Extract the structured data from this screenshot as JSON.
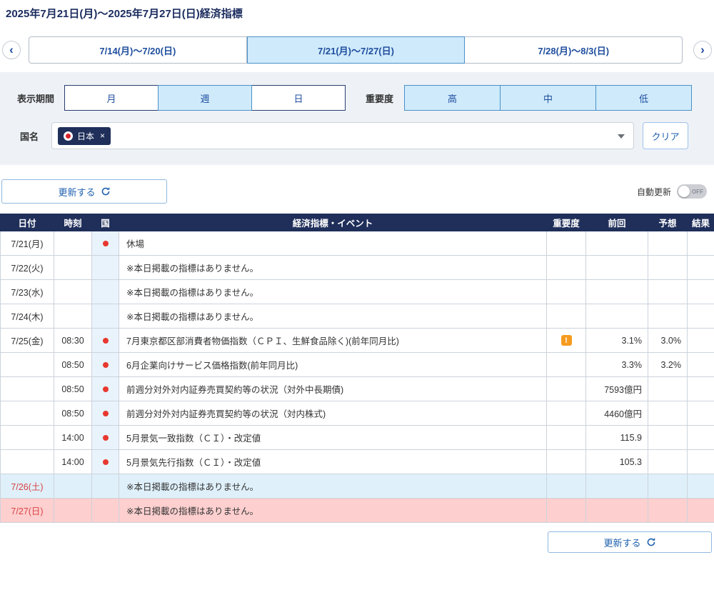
{
  "page": {
    "title": "2025年7月21日(月)～2025年7月27日(日)経済指標"
  },
  "icons": {
    "prev": "‹",
    "next": "›",
    "importance": "!"
  },
  "week_nav": {
    "tabs": [
      {
        "key": "prev-week",
        "label": "7/14(月)～7/20(日)",
        "selected": false
      },
      {
        "key": "current-week",
        "label": "7/21(月)～7/27(日)",
        "selected": true
      },
      {
        "key": "next-week",
        "label": "7/28(月)～8/3(日)",
        "selected": false
      }
    ]
  },
  "filters": {
    "period_label": "表示期間",
    "period_options": [
      {
        "key": "month",
        "label": "月",
        "selected": false
      },
      {
        "key": "week",
        "label": "週",
        "selected": true
      },
      {
        "key": "day",
        "label": "日",
        "selected": false
      }
    ],
    "importance_label": "重要度",
    "importance_options": [
      {
        "key": "high",
        "label": "高",
        "selected": true
      },
      {
        "key": "mid",
        "label": "中",
        "selected": true
      },
      {
        "key": "low",
        "label": "低",
        "selected": true
      }
    ],
    "country_label": "国名",
    "country_tag": {
      "label": "日本",
      "remove": "×"
    },
    "clear_button": "クリア"
  },
  "toolbar": {
    "refresh_button": "更新する",
    "auto_refresh_label": "自動更新",
    "auto_refresh_state": "OFF"
  },
  "table": {
    "headers": [
      "日付",
      "時刻",
      "国",
      "経済指標・イベント",
      "重要度",
      "前回",
      "予想",
      "結果"
    ],
    "rows": [
      {
        "row_type": "weekday",
        "date": "7/21(月)",
        "time": "",
        "country": true,
        "event": "休場",
        "importance": false,
        "previous": "",
        "forecast": "",
        "result": ""
      },
      {
        "row_type": "weekday",
        "date": "7/22(火)",
        "time": "",
        "country": false,
        "event": "※本日掲載の指標はありません。",
        "importance": false,
        "previous": "",
        "forecast": "",
        "result": ""
      },
      {
        "row_type": "weekday",
        "date": "7/23(水)",
        "time": "",
        "country": false,
        "event": "※本日掲載の指標はありません。",
        "importance": false,
        "previous": "",
        "forecast": "",
        "result": ""
      },
      {
        "row_type": "weekday",
        "date": "7/24(木)",
        "time": "",
        "country": false,
        "event": "※本日掲載の指標はありません。",
        "importance": false,
        "previous": "",
        "forecast": "",
        "result": ""
      },
      {
        "row_type": "weekday",
        "date": "7/25(金)",
        "time": "08:30",
        "country": true,
        "event": "7月東京都区部消費者物価指数（ＣＰＩ、生鮮食品除く)(前年同月比)",
        "importance": true,
        "previous": "3.1%",
        "forecast": "3.0%",
        "result": ""
      },
      {
        "row_type": "weekday",
        "date": "",
        "time": "08:50",
        "country": true,
        "event": "6月企業向けサービス価格指数(前年同月比)",
        "importance": false,
        "previous": "3.3%",
        "forecast": "3.2%",
        "result": ""
      },
      {
        "row_type": "weekday",
        "date": "",
        "time": "08:50",
        "country": true,
        "event": "前週分対外対内証券売買契約等の状況（対外中長期債)",
        "importance": false,
        "previous": "7593億円",
        "forecast": "",
        "result": ""
      },
      {
        "row_type": "weekday",
        "date": "",
        "time": "08:50",
        "country": true,
        "event": "前週分対外対内証券売買契約等の状況（対内株式)",
        "importance": false,
        "previous": "4460億円",
        "forecast": "",
        "result": ""
      },
      {
        "row_type": "weekday",
        "date": "",
        "time": "14:00",
        "country": true,
        "event": "5月景気一致指数（ＣＩ）・改定値",
        "importance": false,
        "previous": "115.9",
        "forecast": "",
        "result": ""
      },
      {
        "row_type": "weekday",
        "date": "",
        "time": "14:00",
        "country": true,
        "event": "5月景気先行指数（ＣＩ）・改定値",
        "importance": false,
        "previous": "105.3",
        "forecast": "",
        "result": ""
      },
      {
        "row_type": "saturday",
        "date": "7/26(土)",
        "time": "",
        "country": false,
        "event": "※本日掲載の指標はありません。",
        "importance": false,
        "previous": "",
        "forecast": "",
        "result": ""
      },
      {
        "row_type": "sunday",
        "date": "7/27(日)",
        "time": "",
        "country": false,
        "event": "※本日掲載の指標はありません。",
        "importance": false,
        "previous": "",
        "forecast": "",
        "result": ""
      }
    ]
  },
  "footer": {
    "refresh_button": "更新する"
  }
}
